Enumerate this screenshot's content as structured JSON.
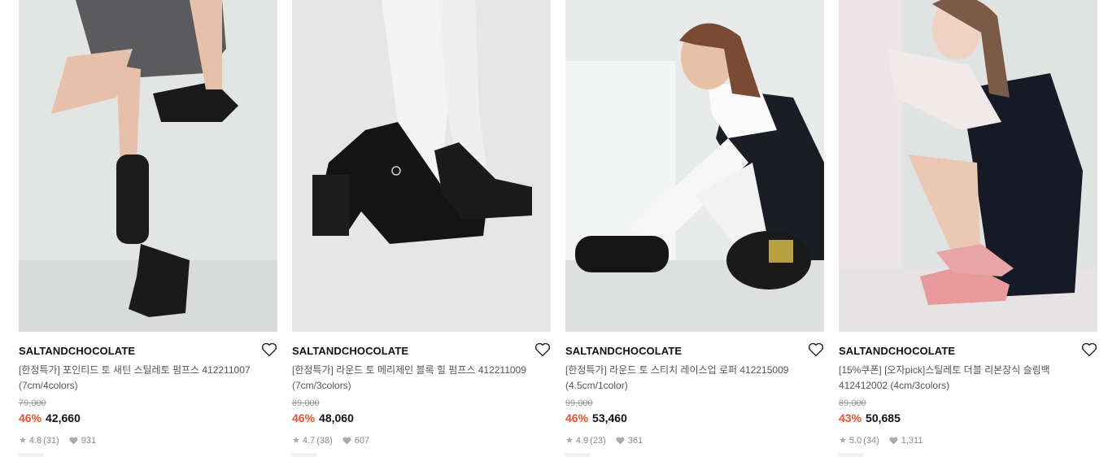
{
  "products": [
    {
      "brand": "SALTANDCHOCOLATE",
      "title": "[한정특가] 포인티드 토 새틴 스틸레토 펌프스 412211007 (7cm/4colors)",
      "original_price": "79,000",
      "discount": "46%",
      "price": "42,660",
      "rating": "4.8",
      "reviews": "(31)",
      "likes": "931",
      "image": "black-satin-pointed-pumps-photo",
      "bg_color": "#e3e4e4"
    },
    {
      "brand": "SALTANDCHOCOLATE",
      "title": "[한정특가] 라운드 토 메리제인 블록 힐 펌프스 412211009 (7cm/3colors)",
      "original_price": "89,000",
      "discount": "46%",
      "price": "48,060",
      "rating": "4.7",
      "reviews": "(38)",
      "likes": "607",
      "image": "black-maryjane-platform-heels-photo",
      "bg_color": "#e6e6e6"
    },
    {
      "brand": "SALTANDCHOCOLATE",
      "title": "[한정특가] 라운드 토 스티치 레이스업 로퍼 412215009 (4.5cm/1color)",
      "original_price": "99,000",
      "discount": "46%",
      "price": "53,460",
      "rating": "4.9",
      "reviews": "(23)",
      "likes": "361",
      "image": "black-lace-up-loafer-model-photo",
      "bg_color": "#e9ebea"
    },
    {
      "brand": "SALTANDCHOCOLATE",
      "title": "[15%쿠폰] [오자pick]스틸레토 더블 리본장식 슬링백 412412002 (4cm/3colors)",
      "original_price": "89,000",
      "discount": "43%",
      "price": "50,685",
      "rating": "5.0",
      "reviews": "(34)",
      "likes": "1,311",
      "image": "pink-ribbon-slingback-model-photo",
      "bg_color": "#dfe3e1"
    }
  ],
  "colors": {
    "discount": "#e8542c",
    "brand": "#111111",
    "muted": "#888888"
  },
  "icons": {
    "wishlist": "heart-outline-icon",
    "rating": "star-icon",
    "likes": "heart-filled-icon"
  }
}
